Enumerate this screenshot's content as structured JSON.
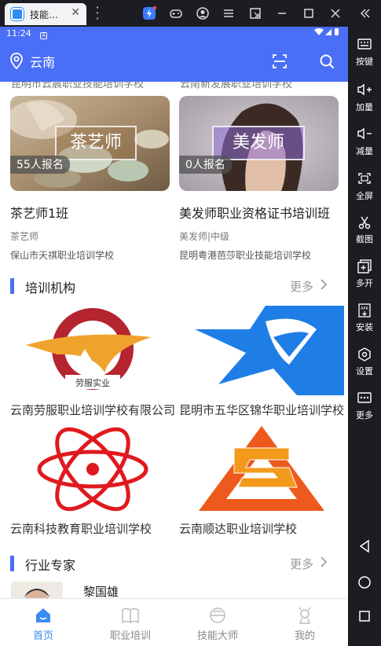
{
  "emulator": {
    "tab_title": "技能…",
    "tab_close": "✕",
    "sidebar": [
      {
        "label": "按键",
        "icon": "keyboard-icon"
      },
      {
        "label": "加量",
        "icon": "volume-up-icon"
      },
      {
        "label": "减量",
        "icon": "volume-down-icon"
      },
      {
        "label": "全屏",
        "icon": "fullscreen-icon"
      },
      {
        "label": "截图",
        "icon": "scissors-icon"
      },
      {
        "label": "多开",
        "icon": "multi-open-icon"
      },
      {
        "label": "安装",
        "icon": "apk-install-icon"
      },
      {
        "label": "设置",
        "icon": "settings-icon"
      },
      {
        "label": "更多",
        "icon": "more-icon"
      }
    ]
  },
  "status": {
    "time": "11:24"
  },
  "header": {
    "city": "云南"
  },
  "cut_row": {
    "left": "昆明市云晨职业技能培训学校",
    "right": "云南新发展职业培训学校"
  },
  "courses": [
    {
      "sign": "茶艺师",
      "count": "55人报名",
      "name": "茶艺师1班",
      "meta": "茶艺师",
      "school": "保山市天祺职业培训学校"
    },
    {
      "sign": "美发师",
      "count": "0人报名",
      "name": "美发师职业资格证书培训班",
      "meta": "美发师|中级",
      "school": "昆明粤港芭莎职业技能培训学校"
    }
  ],
  "institutions": {
    "title": "培训机构",
    "more": "更多",
    "items": [
      {
        "name": "云南劳服职业培训学校有限公司",
        "logo_text": "劳服实业"
      },
      {
        "name": "昆明市五华区锦华职业培训学校"
      },
      {
        "name": "云南科技教育职业培训学校"
      },
      {
        "name": "云南顺达职业培训学校"
      }
    ]
  },
  "experts": {
    "title": "行业专家",
    "more": "更多",
    "first_name": "黎国雄"
  },
  "tabbar": [
    {
      "label": "首页",
      "active": true
    },
    {
      "label": "职业培训",
      "active": false
    },
    {
      "label": "技能大师",
      "active": false
    },
    {
      "label": "我的",
      "active": false
    }
  ],
  "colors": {
    "primary": "#4a6ef5",
    "tab_active": "#3a8bf2"
  }
}
